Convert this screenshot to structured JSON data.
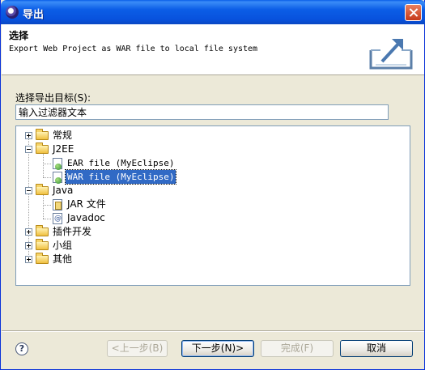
{
  "window": {
    "title": "导出"
  },
  "header": {
    "title": "选择",
    "description": "Export Web Project as WAR file to local file system",
    "icon": "export-icon"
  },
  "filter": {
    "label": "选择导出目标(S):",
    "placeholder": "输入过滤器文本"
  },
  "tree": {
    "items": [
      {
        "label": "常规",
        "level": 0,
        "expander": "plus",
        "icon": "folder-icon"
      },
      {
        "label": "J2EE",
        "level": 0,
        "expander": "minus",
        "icon": "folder-icon"
      },
      {
        "label": "EAR file (MyEclipse)",
        "level": 1,
        "icon": "ear-file-icon"
      },
      {
        "label": "WAR file (MyEclipse)",
        "level": 1,
        "icon": "war-file-icon",
        "selected": true
      },
      {
        "label": "Java",
        "level": 0,
        "expander": "minus",
        "icon": "folder-icon"
      },
      {
        "label": "JAR 文件",
        "level": 1,
        "icon": "jar-file-icon"
      },
      {
        "label": "Javadoc",
        "level": 1,
        "icon": "javadoc-icon"
      },
      {
        "label": "插件开发",
        "level": 0,
        "expander": "plus",
        "icon": "folder-icon"
      },
      {
        "label": "小组",
        "level": 0,
        "expander": "plus",
        "icon": "folder-icon"
      },
      {
        "label": "其他",
        "level": 0,
        "expander": "plus",
        "icon": "folder-icon"
      }
    ]
  },
  "buttons": {
    "back": "<上一步(B)",
    "next": "下一步(N)>",
    "finish": "完成(F)",
    "cancel": "取消"
  },
  "colors": {
    "titlebar": "#0a5fe8",
    "selection": "#316ac5",
    "dialog_bg": "#ece9d8"
  }
}
